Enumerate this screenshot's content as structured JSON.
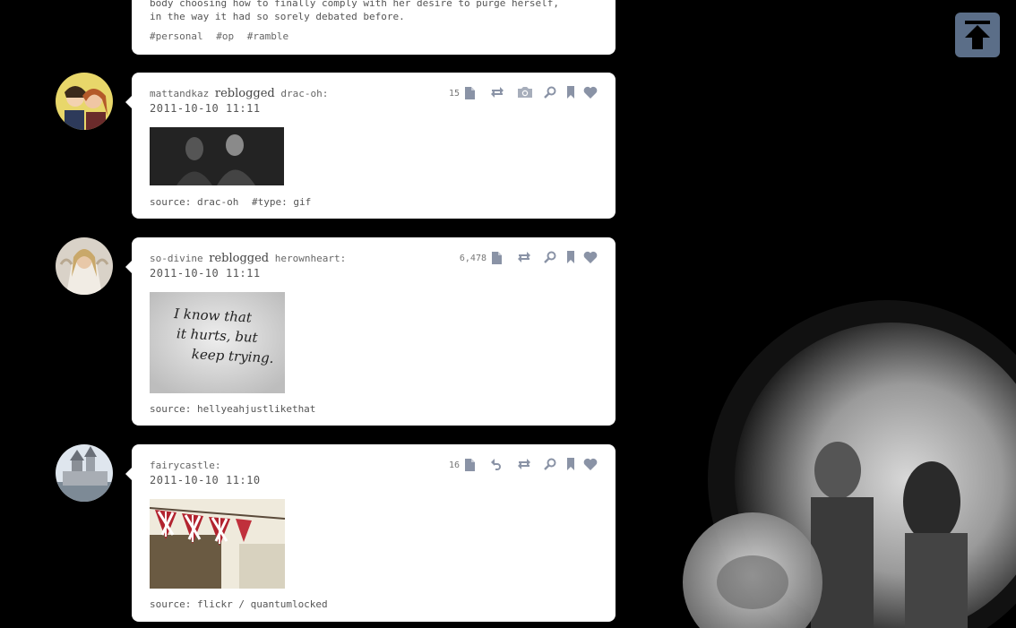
{
  "top_post": {
    "text_lines": [
      "body choosing how to finally comply with her desire to purge herself,",
      "in the way it had so sorely debated before."
    ],
    "tags": [
      "#personal",
      "#op",
      "#ramble"
    ]
  },
  "posts": [
    {
      "user": "mattandkaz",
      "verb": "reblogged",
      "source_user": "drac-oh:",
      "date": "2011-10-10 11:11",
      "notes": "15",
      "caption": [
        "source: drac-oh",
        "#type: gif"
      ]
    },
    {
      "user": "so-divine",
      "verb": "reblogged",
      "source_user": "herownheart:",
      "date": "2011-10-10 11:11",
      "notes": "6,478",
      "image_text": [
        "I know that",
        "it hurts, but",
        "keep trying."
      ],
      "caption": [
        "source: hellyeahjustlikethat"
      ]
    },
    {
      "user": "fairycastle:",
      "verb": "",
      "source_user": "",
      "date": "2011-10-10 11:10",
      "notes": "16",
      "caption": [
        "source: flickr / quantumlocked"
      ]
    }
  ],
  "colors": {
    "background": "#000000",
    "card": "#ffffff",
    "icon": "#8a93a6",
    "top_button": "#5b6e88"
  },
  "icons": [
    "document-icon",
    "reblog-icon",
    "camera-icon",
    "reply-icon",
    "search-icon",
    "bookmark-icon",
    "heart-icon",
    "arrow-up-icon"
  ]
}
